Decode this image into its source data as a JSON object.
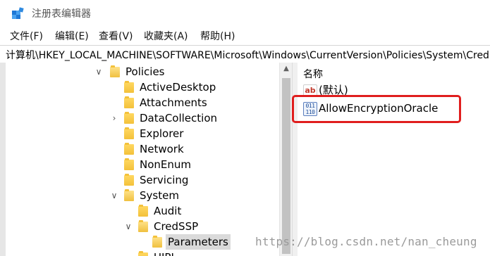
{
  "window": {
    "title": "注册表编辑器",
    "icon": "registry-editor-icon"
  },
  "menu": {
    "items": [
      "文件(F)",
      "编辑(E)",
      "查看(V)",
      "收藏夹(A)",
      "帮助(H)"
    ]
  },
  "address": {
    "path": "计算机\\HKEY_LOCAL_MACHINE\\SOFTWARE\\Microsoft\\Windows\\CurrentVersion\\Policies\\System\\CredSSP\\Parameters"
  },
  "tree": {
    "items": [
      {
        "label": "Policies",
        "expanded": true
      },
      {
        "label": "ActiveDesktop"
      },
      {
        "label": "Attachments"
      },
      {
        "label": "DataCollection",
        "has_children": true
      },
      {
        "label": "Explorer"
      },
      {
        "label": "Network"
      },
      {
        "label": "NonEnum"
      },
      {
        "label": "Servicing"
      },
      {
        "label": "System",
        "expanded": true
      },
      {
        "label": "Audit"
      },
      {
        "label": "CredSSP",
        "expanded": true
      },
      {
        "label": "Parameters",
        "selected": true
      },
      {
        "label": "UIPI"
      }
    ]
  },
  "list": {
    "column_name": "名称",
    "rows": [
      {
        "name": "(默认)",
        "icon": "string-value-icon"
      },
      {
        "name": "AllowEncryptionOracle",
        "icon": "binary-value-icon"
      }
    ]
  },
  "highlight_color": "#e01e1e",
  "watermark": "https://blog.csdn.net/nan_cheung"
}
